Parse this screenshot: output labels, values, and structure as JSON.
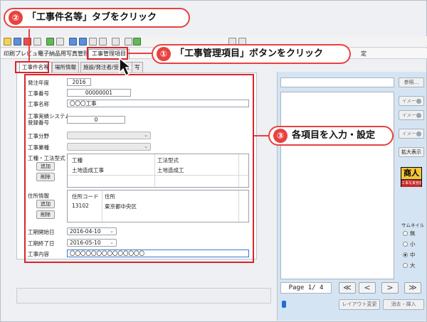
{
  "menubar": {
    "items": [
      "印刷プレビュー",
      "電子納品用写真管理",
      "工事管理項目",
      "定"
    ]
  },
  "subtabs": [
    "工事件名等",
    "場所情報",
    "施設/発注者/受注者",
    "写"
  ],
  "form": {
    "fiscal_year_label": "発注年度",
    "fiscal_year_value": "2016",
    "project_number_label": "工事番号",
    "project_number_value": "00000001",
    "project_name_label": "工事名称",
    "project_name_value": "〇〇〇工事",
    "reg_number_label_1": "工事実績システム",
    "reg_number_label_2": "登録番号",
    "reg_number_value": "0",
    "field_label": "工事分野",
    "industry_label": "工事業種",
    "method_label": "工種・工法型式",
    "method_add": "追加",
    "method_delete": "削除",
    "method_grid": {
      "headers": [
        "工種",
        "工法型式"
      ],
      "rows": [
        [
          "土地造成工事",
          "土地造成工"
        ]
      ]
    },
    "address_label": "住所情報",
    "address_add": "追加",
    "address_delete": "削除",
    "address_grid": {
      "headers": [
        "住所コード",
        "住所"
      ],
      "rows": [
        [
          "13102",
          "東京都中央区"
        ]
      ]
    },
    "start_label": "工期開始日",
    "start_value": "2016-04-10",
    "end_label": "工期終了日",
    "end_value": "2016-05-10",
    "content_label": "工事内容",
    "content_value": "〇〇〇〇〇〇〇〇〇〇〇〇〇〇"
  },
  "right_pane": {
    "browse_button": "参照...",
    "image_buttons": [
      "イメージ",
      "イメージ",
      "イメージ"
    ],
    "enlarge_button": "拡大表示",
    "logo_top": "商人",
    "logo_bottom": "工事写真管理",
    "thumb_title": "サムネイル",
    "thumb_options": [
      "無",
      "小",
      "中",
      "大"
    ],
    "thumb_selected": "中",
    "pager_text": "Page 1/ 4",
    "nav": [
      "≪",
      "<",
      ">",
      "≫"
    ],
    "layout_button": "レイアウト変更",
    "delete_insert_button": "消去・挿入"
  },
  "callouts": {
    "step1": {
      "num": "①",
      "text": "「工事管理項目」ボタンをクリック"
    },
    "step2": {
      "num": "②",
      "text": "「工事件名等」タブをクリック"
    },
    "step3": {
      "num": "③",
      "text": "各項目を入力・設定"
    }
  },
  "colors": {
    "callout_red": "#e8423f",
    "outline_red": "#d7262d",
    "right_pane_bg": "#d5e4f2"
  }
}
